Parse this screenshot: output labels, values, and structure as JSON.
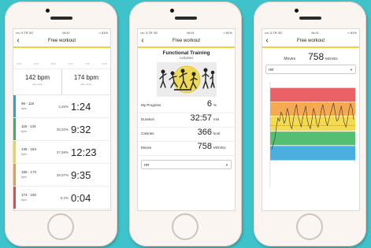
{
  "status_bar": {
    "carrier": "•••• 3-TR  3G",
    "time": "16:41",
    "battery": "≈ 81%"
  },
  "nav": {
    "back": "‹",
    "title": "Free workout"
  },
  "screen1": {
    "x_ticks": [
      "00:00",
      "04:00",
      "08:00",
      "12:00",
      "16:00",
      "20:00"
    ],
    "avg": {
      "value": "142 bpm",
      "label": "Avg value"
    },
    "max": {
      "value": "174 bpm",
      "label": "Max value"
    },
    "zones": [
      {
        "range": "96 - 115",
        "unit": "bpm",
        "pct": "4,25%",
        "time": "1:24",
        "color": "#2aa0d8"
      },
      {
        "range": "116 - 134",
        "unit": "bpm",
        "pct": "28,02%",
        "time": "9:32",
        "color": "#36b459"
      },
      {
        "range": "135 - 154",
        "unit": "bpm",
        "pct": "37,56%",
        "time": "12:23",
        "color": "#f2d431"
      },
      {
        "range": "155 - 173",
        "unit": "bpm",
        "pct": "29,07%",
        "time": "9:35",
        "color": "#f39a33"
      },
      {
        "range": "174 - 192",
        "unit": "bpm",
        "pct": "0,2%",
        "time": "0:04",
        "color": "#e5474b"
      }
    ]
  },
  "screen2": {
    "activity_title": "Functional Training",
    "activity_sub": "Activities",
    "rows": [
      {
        "label": "My Progress",
        "value": "6",
        "unit": "%"
      },
      {
        "label": "Duration",
        "value": "32:57",
        "unit": "min"
      },
      {
        "label": "Calories",
        "value": "366",
        "unit": "kcal"
      },
      {
        "label": "Moves",
        "value": "758",
        "unit": "MOVEs"
      }
    ],
    "select_value": "HR",
    "progress_fraction": 0.06
  },
  "screen3": {
    "moves_label": "Moves",
    "moves_value": "758",
    "moves_unit": "MOVEs",
    "select_value": "HR"
  },
  "chart_data": {
    "type": "line",
    "series": [
      {
        "values": [
          110,
          118,
          125,
          140,
          152,
          148,
          160,
          155,
          145,
          150,
          165,
          158,
          142,
          138,
          150,
          162,
          170,
          155,
          148,
          140,
          152,
          160,
          168,
          150,
          142,
          138,
          150,
          165,
          158,
          145,
          140,
          150,
          162,
          170,
          160,
          148,
          142,
          150,
          158,
          165,
          172,
          160,
          148,
          150,
          160,
          168,
          155,
          145,
          140,
          150,
          163,
          171,
          165,
          150
        ]
      }
    ],
    "zones": [
      {
        "from": 96,
        "to": 115,
        "color": "#2aa0d8"
      },
      {
        "from": 116,
        "to": 134,
        "color": "#36b459"
      },
      {
        "from": 135,
        "to": 154,
        "color": "#f2d431"
      },
      {
        "from": 155,
        "to": 173,
        "color": "#f39a33"
      },
      {
        "from": 174,
        "to": 192,
        "color": "#e5474b"
      }
    ],
    "ylim": [
      60,
      200
    ],
    "avg": 142,
    "max": 174
  },
  "colors": {
    "accent": "#f1d13b",
    "background": "#3fc3cb"
  }
}
